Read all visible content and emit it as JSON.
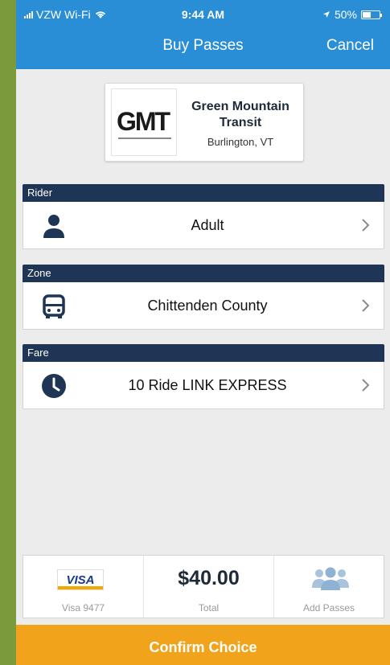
{
  "status_bar": {
    "carrier": "VZW Wi-Fi",
    "time": "9:44 AM",
    "battery": "50%"
  },
  "nav": {
    "title": "Buy Passes",
    "cancel_label": "Cancel"
  },
  "agency": {
    "logo_text": "GMT",
    "name_line1": "Green Mountain",
    "name_line2": "Transit",
    "city": "Burlington, VT"
  },
  "rider": {
    "header": "Rider",
    "value": "Adult",
    "icon": "person-icon"
  },
  "zone": {
    "header": "Zone",
    "value": "Chittenden County",
    "icon": "bus-icon"
  },
  "fare": {
    "header": "Fare",
    "value": "10 Ride LINK EXPRESS",
    "icon": "clock-icon"
  },
  "summary": {
    "card_brand": "VISA",
    "card_label": "Visa 9477",
    "total_value": "$40.00",
    "total_label": "Total",
    "add_label": "Add Passes"
  },
  "confirm_label": "Confirm Choice",
  "colors": {
    "header_blue": "#2a8ed6",
    "section_navy": "#1f3555",
    "confirm_orange": "#f2a31c",
    "background": "#ececec"
  }
}
